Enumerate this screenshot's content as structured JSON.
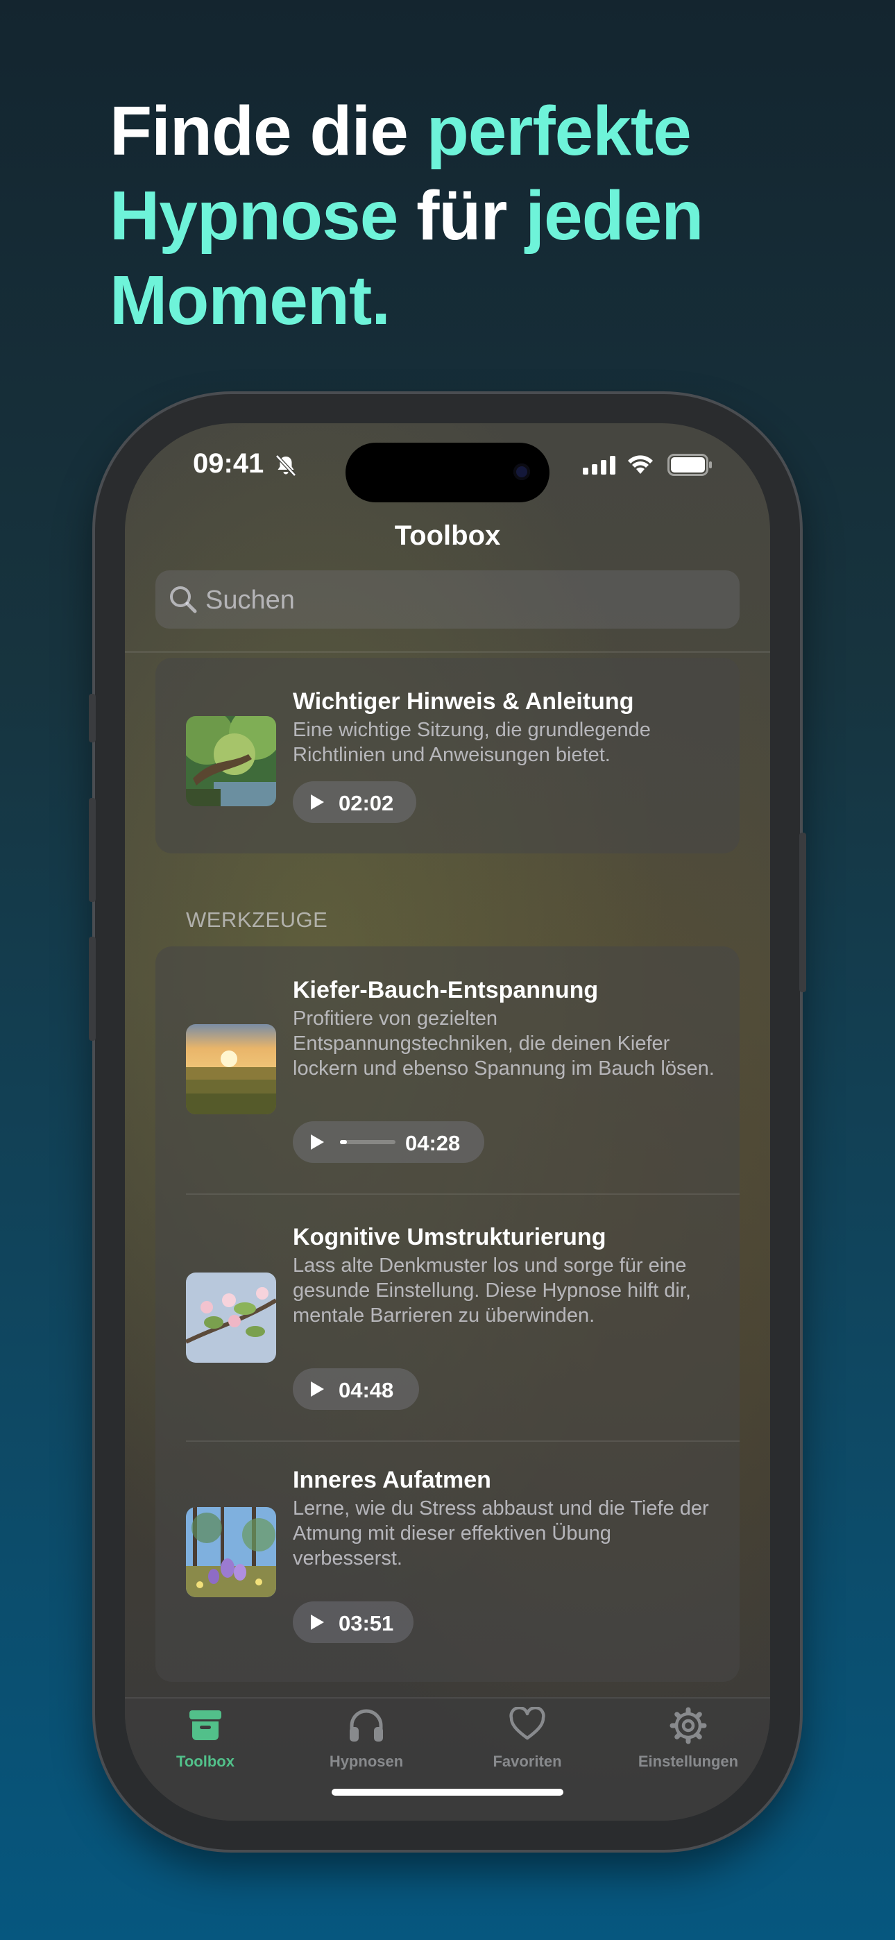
{
  "headline": {
    "parts": [
      {
        "text": "Finde die ",
        "accent": false
      },
      {
        "text": "perfekte",
        "accent": true
      },
      {
        "text": "Hypnose",
        "accent": true
      },
      {
        "text": " für ",
        "accent": false
      },
      {
        "text": "jeden",
        "accent": true
      },
      {
        "text": "Moment.",
        "accent": true
      }
    ],
    "accent_color": "#6ef3d9"
  },
  "status_bar": {
    "time": "09:41",
    "icons": [
      "bell-slash-icon",
      "cellular-signal-icon",
      "wifi-icon",
      "battery-icon"
    ]
  },
  "nav": {
    "title": "Toolbox"
  },
  "search": {
    "placeholder": "Suchen"
  },
  "featured": {
    "title": "Wichtiger Hinweis & Anleitung",
    "description": "Eine wichtige Sitzung, die grundlegende Richtlinien und Anweisungen bietet.",
    "duration": "02:02",
    "thumbnail": "forest-stream"
  },
  "section": {
    "label": "WERKZEUGE"
  },
  "items": [
    {
      "title": "Kiefer-Bauch-Entspannung",
      "description": "Profitiere von gezielten Entspannungstechniken, die deinen Kiefer lockern und ebenso Spannung im Bauch lösen.",
      "duration": "04:28",
      "progress": 0.12,
      "thumbnail": "sunset-field"
    },
    {
      "title": "Kognitive Umstrukturierung",
      "description": "Lass alte Denkmuster los und sorge für eine gesunde Einstellung. Diese Hypnose hilft dir, mentale Barrieren zu überwinden.",
      "duration": "04:48",
      "thumbnail": "blossom-branch"
    },
    {
      "title": "Inneres Aufatmen",
      "description": "Lerne, wie du Stress abbaust und die Tiefe der Atmung mit dieser effektiven Übung verbesserst.",
      "duration": "03:51",
      "thumbnail": "crocus-meadow"
    }
  ],
  "tabs": [
    {
      "label": "Toolbox",
      "icon": "archive-box-icon",
      "active": true
    },
    {
      "label": "Hypnosen",
      "icon": "headphones-icon",
      "active": false
    },
    {
      "label": "Favoriten",
      "icon": "heart-icon",
      "active": false
    },
    {
      "label": "Einstellungen",
      "icon": "gear-icon",
      "active": false
    }
  ],
  "colors": {
    "tab_active": "#52c08a",
    "tab_inactive": "#888a8d",
    "accent": "#6ef3d9"
  }
}
